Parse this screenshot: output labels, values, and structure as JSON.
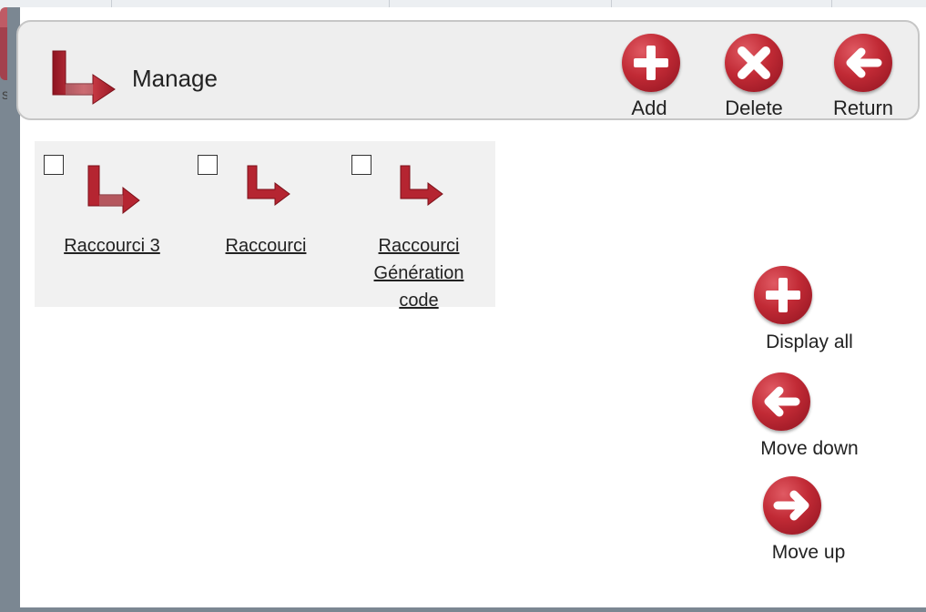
{
  "dialog": {
    "title": "Manage",
    "toolbar": {
      "add_label": "Add",
      "delete_label": "Delete",
      "return_label": "Return"
    }
  },
  "items": [
    {
      "label": "Raccourci 3",
      "checked": false
    },
    {
      "label": "Raccourci",
      "checked": false
    },
    {
      "label": "Raccourci Génération code",
      "checked": false
    }
  ],
  "side_actions": {
    "display_all_label": "Display all",
    "move_down_label": "Move down",
    "move_up_label": "Move up"
  },
  "background": {
    "fragment": "si"
  },
  "colors": {
    "accent_red": "#c12a35",
    "header_bg": "#eeeeee",
    "panel_bg": "#f1f1f1",
    "frame": "#7b8792"
  },
  "icons": {
    "header": "shortcut-arrow-icon",
    "add": "plus-icon",
    "delete": "x-icon",
    "return": "arrow-left-icon",
    "display_all": "plus-icon",
    "move_down": "arrow-left-icon",
    "move_up": "arrow-right-icon"
  }
}
